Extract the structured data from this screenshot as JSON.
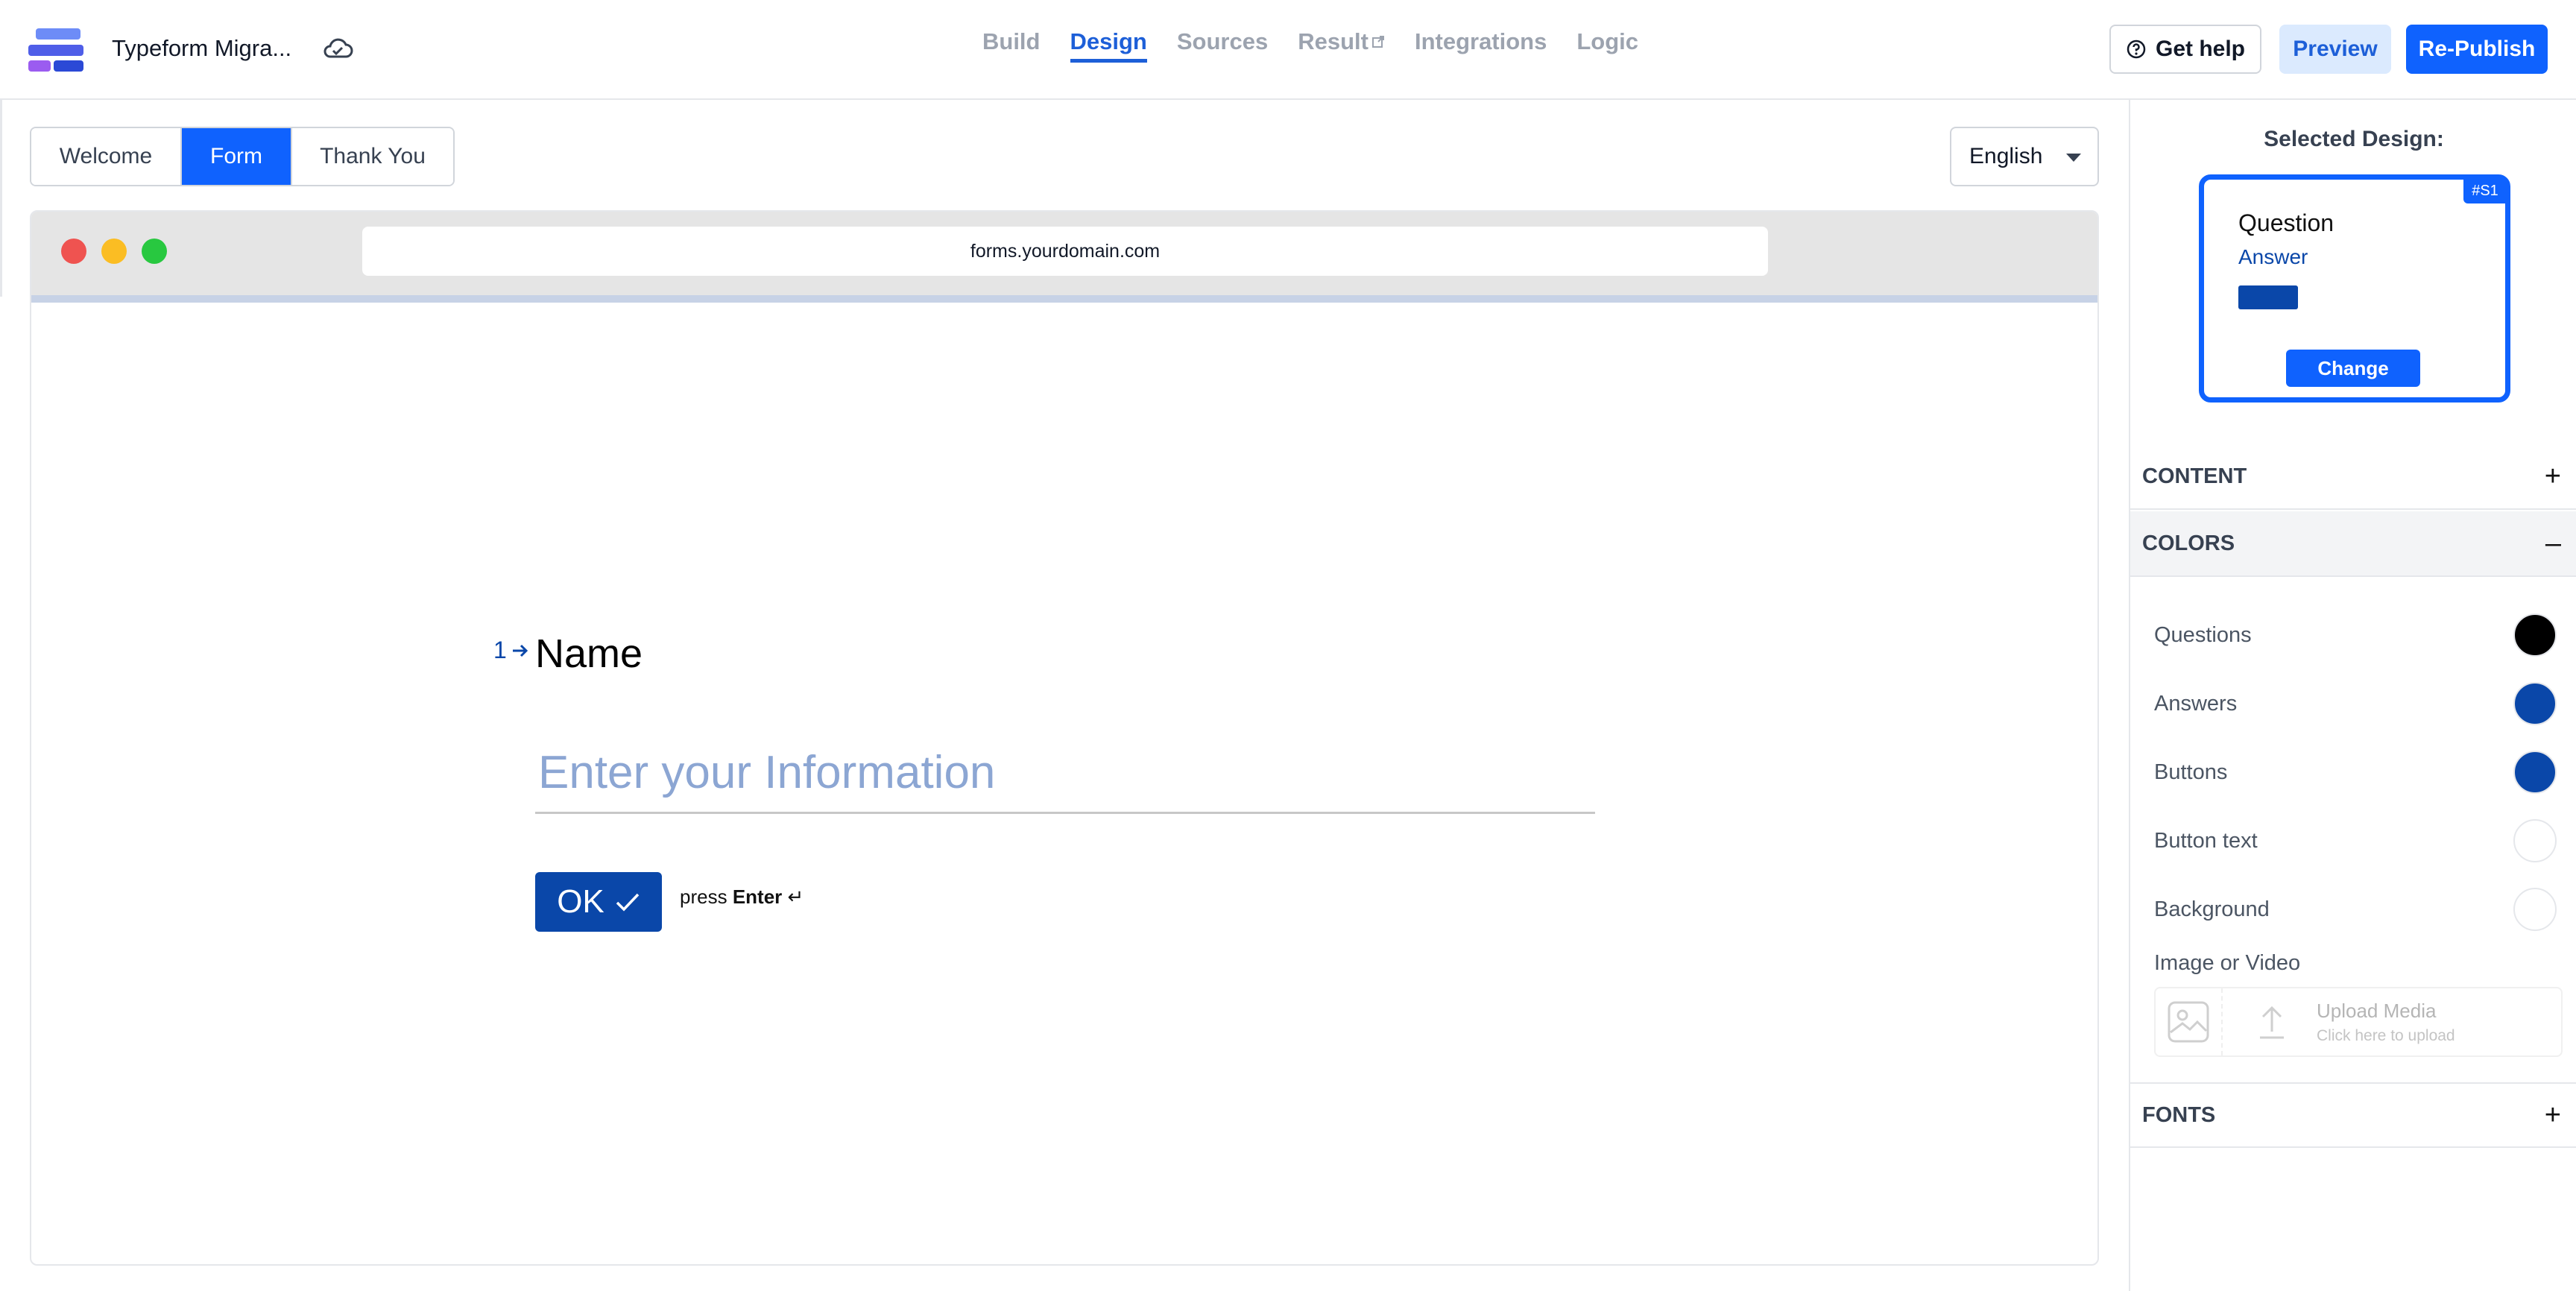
{
  "app": {
    "title": "Typeform Migra..."
  },
  "nav": {
    "items": [
      "Build",
      "Design",
      "Sources",
      "Result",
      "Integrations",
      "Logic"
    ],
    "active": "Design"
  },
  "header_actions": {
    "help_label": "Get help",
    "preview_label": "Preview",
    "publish_label": "Re-Publish"
  },
  "page_tabs": {
    "items": [
      "Welcome",
      "Form",
      "Thank You"
    ],
    "active": "Form"
  },
  "language": {
    "selected": "English"
  },
  "browser": {
    "url": "forms.yourdomain.com",
    "progress": 0
  },
  "question": {
    "number": "1",
    "title": "Name",
    "placeholder": "Enter your Information",
    "ok_label": "OK",
    "hint_prefix": "press",
    "hint_key": "Enter",
    "hint_symbol": "↵"
  },
  "design_panel": {
    "selected_label": "Selected Design:",
    "tag": "#S1",
    "question_text": "Question",
    "answer_text": "Answer",
    "change_label": "Change"
  },
  "sections": {
    "content": {
      "label": "CONTENT",
      "toggle": "+"
    },
    "colors": {
      "label": "COLORS",
      "toggle": "–"
    },
    "fonts": {
      "label": "FONTS",
      "toggle": "+"
    }
  },
  "colors": [
    {
      "label": "Questions",
      "value": "#000000"
    },
    {
      "label": "Answers",
      "value": "#0a47a9"
    },
    {
      "label": "Buttons",
      "value": "#0a47a9"
    },
    {
      "label": "Button text",
      "value": "#ffffff"
    },
    {
      "label": "Background",
      "value": "#ffffff"
    }
  ],
  "media": {
    "label": "Image or Video",
    "upload_title": "Upload Media",
    "upload_hint": "Click here to upload"
  },
  "theme": {
    "primary": "#0f62fe",
    "answer": "#0a47a9"
  }
}
